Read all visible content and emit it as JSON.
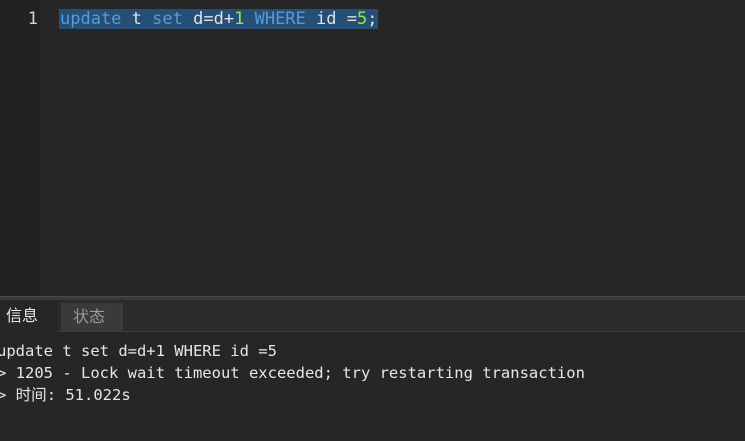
{
  "editor": {
    "line_number": "1",
    "code": {
      "kw_update": "update",
      "sp1": " ",
      "t": "t",
      "sp2": " ",
      "kw_set": "set",
      "sp3": " ",
      "assign": "d=d+",
      "one": "1",
      "sp4": " ",
      "kw_where": "WHERE",
      "sp5": " ",
      "id_eq": "id =",
      "five": "5",
      "semicolon": ";"
    }
  },
  "tabs": {
    "info": "信息",
    "status": "状态"
  },
  "output": {
    "line1": "update t set d=d+1 WHERE id =5",
    "line2": "> 1205 - Lock wait timeout exceeded; try restarting transaction",
    "line3_prefix": "> ",
    "line3_label": "时间",
    "line3_value": ": 51.022s"
  },
  "colors": {
    "background": "#262626",
    "selection": "#264f78",
    "keyword": "#569cd6",
    "number": "#9fe04a"
  }
}
